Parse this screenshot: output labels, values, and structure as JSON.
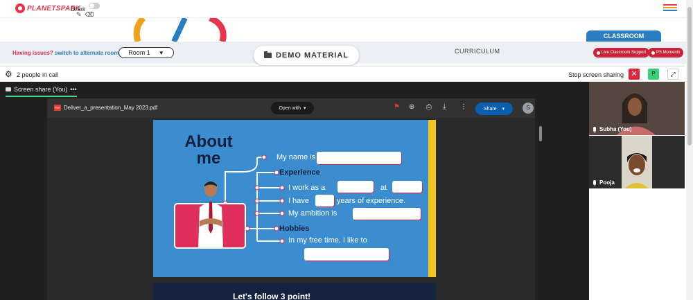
{
  "brand": {
    "name": "PLANETSPARK",
    "color": "#e8354d"
  },
  "draw": {
    "label": "Draw",
    "tools": [
      "pencil-icon",
      "eraser-icon"
    ]
  },
  "room_bar": {
    "issue_text": "Having issues?",
    "alt_link": "switch to alternate room",
    "room_select": "Room 1",
    "demo_material": "DEMO MATERIAL",
    "curriculum": "CURRICULUM",
    "classroom": "CLASSROOM",
    "live_support": "Live Classroom Support",
    "ps_moments": "PS Moments"
  },
  "call": {
    "people": "2 people in call",
    "stop_sharing": "Stop screen sharing",
    "close_symbol": "✕",
    "participant_initial": "P",
    "share_tab": "Screen share (You)",
    "share_tab_more": "•••"
  },
  "viewer": {
    "file_badge": "PDF",
    "filename": "Deliver_a_presentation_May 2023.pdf",
    "open_with": "Open with",
    "share": "Share",
    "avatar_initial": "S"
  },
  "slide": {
    "title_line1": "About",
    "title_line2": "me",
    "name_line": "My name is",
    "experience_heading": "Experience",
    "work_line": "I work as a",
    "at_word": "at",
    "have_line": "I have",
    "years_line": "years of experience.",
    "ambition_line": "My ambition is",
    "hobbies_heading": "Hobbies",
    "free_time_line": "In my free time, I like to",
    "next_slide_text": "Let's follow 3 point!"
  },
  "participants": [
    {
      "name": "Subha (You)"
    },
    {
      "name": "Pooja"
    }
  ],
  "colors": {
    "accent_red": "#c8233b",
    "accent_blue": "#2a7dc0",
    "slide_blue": "#3b8dd0",
    "slide_yellow": "#f0c21c",
    "share_green": "#4fd38c"
  }
}
